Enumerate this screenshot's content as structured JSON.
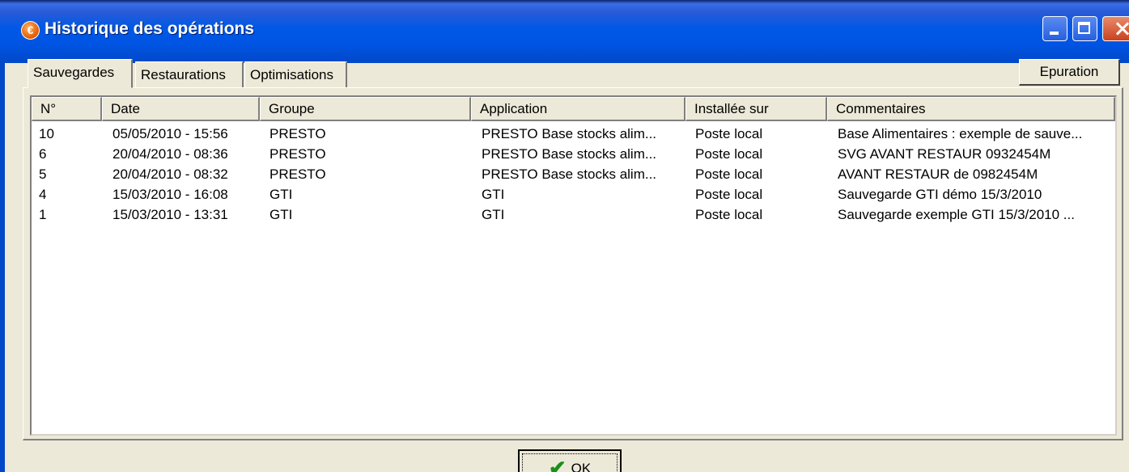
{
  "window": {
    "title": "Historique des opérations",
    "app_icon_glyph": "€"
  },
  "tabs": [
    {
      "label": "Sauvegardes",
      "active": true
    },
    {
      "label": "Restaurations",
      "active": false
    },
    {
      "label": "Optimisations",
      "active": false
    }
  ],
  "epuration_label": "Epuration",
  "table": {
    "columns": [
      "N°",
      "Date",
      "Groupe",
      "Application",
      "Installée sur",
      "Commentaires"
    ],
    "rows": [
      [
        "10",
        "05/05/2010 - 15:56",
        "PRESTO",
        "PRESTO Base stocks alim...",
        "Poste local",
        "Base Alimentaires : exemple de sauve..."
      ],
      [
        "6",
        "20/04/2010 - 08:36",
        "PRESTO",
        "PRESTO Base stocks alim...",
        "Poste local",
        "SVG AVANT RESTAUR 0932454M"
      ],
      [
        "5",
        "20/04/2010 - 08:32",
        "PRESTO",
        "PRESTO Base stocks alim...",
        "Poste local",
        "AVANT RESTAUR de 0982454M"
      ],
      [
        "4",
        "15/03/2010 - 16:08",
        "GTI",
        "GTI",
        "Poste local",
        "Sauvegarde GTI démo 15/3/2010"
      ],
      [
        "1",
        "15/03/2010 - 13:31",
        "GTI",
        "GTI",
        "Poste local",
        "Sauvegarde exemple GTI 15/3/2010 ..."
      ]
    ]
  },
  "ok_label": "OK",
  "icons": {
    "ok": "checkmark-icon",
    "check_color": "#1A8F1A"
  }
}
